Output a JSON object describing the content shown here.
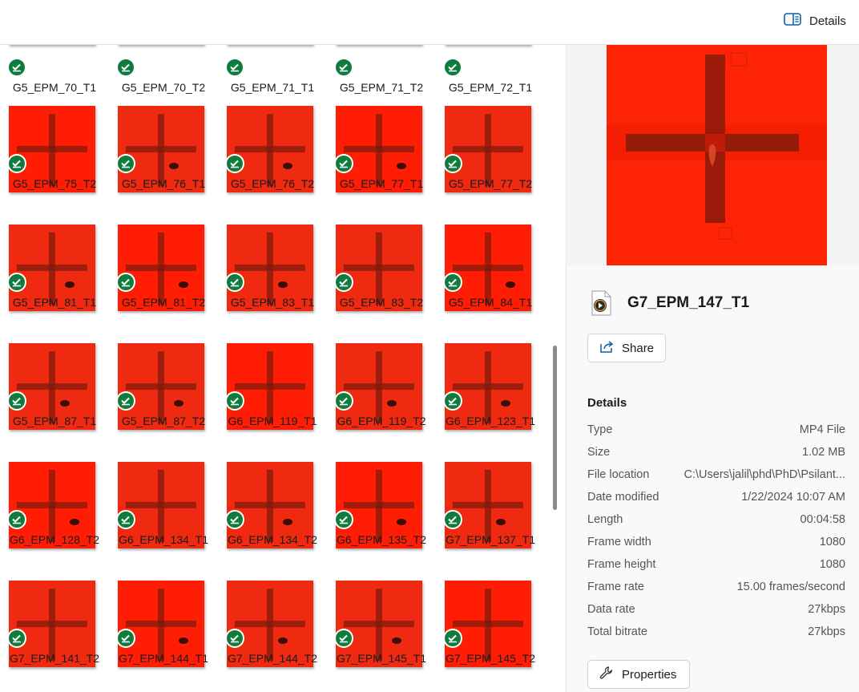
{
  "topbar": {
    "details_label": "Details"
  },
  "thumbnails": [
    "G5_EPM_70_T1",
    "G5_EPM_70_T2",
    "G5_EPM_71_T1",
    "G5_EPM_71_T2",
    "G5_EPM_72_T1",
    "G5_EPM_75_T2",
    "G5_EPM_76_T1",
    "G5_EPM_76_T2",
    "G5_EPM_77_T1",
    "G5_EPM_77_T2",
    "G5_EPM_81_T1",
    "G5_EPM_81_T2",
    "G5_EPM_83_T1",
    "G5_EPM_83_T2",
    "G5_EPM_84_T1",
    "G5_EPM_87_T1",
    "G5_EPM_87_T2",
    "G6_EPM_119_T1",
    "G6_EPM_119_T2",
    "G6_EPM_123_T1",
    "G6_EPM_128_T2",
    "G6_EPM_134_T1",
    "G6_EPM_134_T2",
    "G6_EPM_135_T2",
    "G7_EPM_137_T1",
    "G7_EPM_141_T2",
    "G7_EPM_144_T1",
    "G7_EPM_144_T2",
    "G7_EPM_145_T1",
    "G7_EPM_145_T2"
  ],
  "panel": {
    "file_name": "G7_EPM_147_T1",
    "share_label": "Share",
    "details_heading": "Details",
    "properties_label": "Properties",
    "details": [
      {
        "key": "Type",
        "value": "MP4 File"
      },
      {
        "key": "Size",
        "value": "1.02 MB"
      },
      {
        "key": "File location",
        "value": "C:\\Users\\jalil\\phd\\PhD\\Psilant..."
      },
      {
        "key": "Date modified",
        "value": "1/22/2024 10:07 AM"
      },
      {
        "key": "Length",
        "value": "00:04:58"
      },
      {
        "key": "Frame width",
        "value": "1080"
      },
      {
        "key": "Frame height",
        "value": "1080"
      },
      {
        "key": "Frame rate",
        "value": "15.00 frames/second"
      },
      {
        "key": "Data rate",
        "value": "27kbps"
      },
      {
        "key": "Total bitrate",
        "value": "27kbps"
      }
    ]
  },
  "colors": {
    "accent_check": "#0f7b3c",
    "thumb_red": "#ff2a0a"
  }
}
